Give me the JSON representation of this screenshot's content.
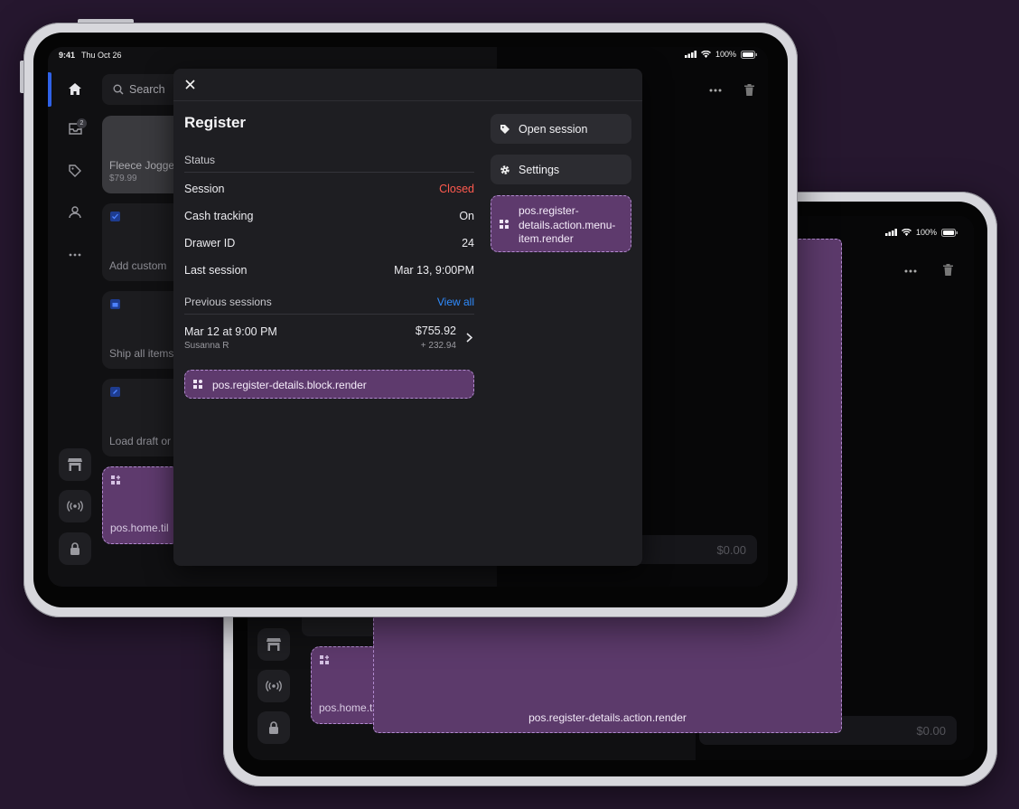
{
  "status_bar": {
    "time": "9:41",
    "date": "Thu Oct 26",
    "battery": "100%"
  },
  "status_bar_back": {
    "battery": "100%"
  },
  "home": {
    "search_placeholder": "Search",
    "inbox_badge": "2",
    "product_tile": {
      "name": "Fleece Jogge",
      "price": "$79.99"
    },
    "tiles": [
      "Add custom",
      "Ship all items",
      "Load draft or"
    ],
    "extension_tile_label": "pos.home.til",
    "cart_total": "$0.00"
  },
  "back_tablet": {
    "extension_tile_label": "pos.home.til",
    "action_target_label": "pos.register-details.action.render",
    "cart_total": "$0.00"
  },
  "register": {
    "title": "Register",
    "status_heading": "Status",
    "rows": [
      {
        "label": "Session",
        "value": "Closed",
        "value_color": "#ff5a4f"
      },
      {
        "label": "Cash tracking",
        "value": "On",
        "value_color": "#ececf0"
      },
      {
        "label": "Drawer ID",
        "value": "24",
        "value_color": "#ececf0"
      },
      {
        "label": "Last session",
        "value": "Mar 13, 9:00PM",
        "value_color": "#ececf0"
      }
    ],
    "previous_heading": "Previous sessions",
    "view_all": "View all",
    "session": {
      "date": "Mar 12 at 9:00 PM",
      "user": "Susanna R",
      "amount": "$755.92",
      "delta": "+ 232.94"
    },
    "block_target_label": "pos.register-details.block.render",
    "actions": {
      "open_session": "Open session",
      "settings": "Settings",
      "menu_item_target_label": "pos.register-details.action.menu-item.render"
    }
  },
  "colors": {
    "background": "#26172f",
    "accent_blue": "#2f8cff",
    "closed_red": "#ff5a4f",
    "extension_purple": "#5e3a6d"
  }
}
